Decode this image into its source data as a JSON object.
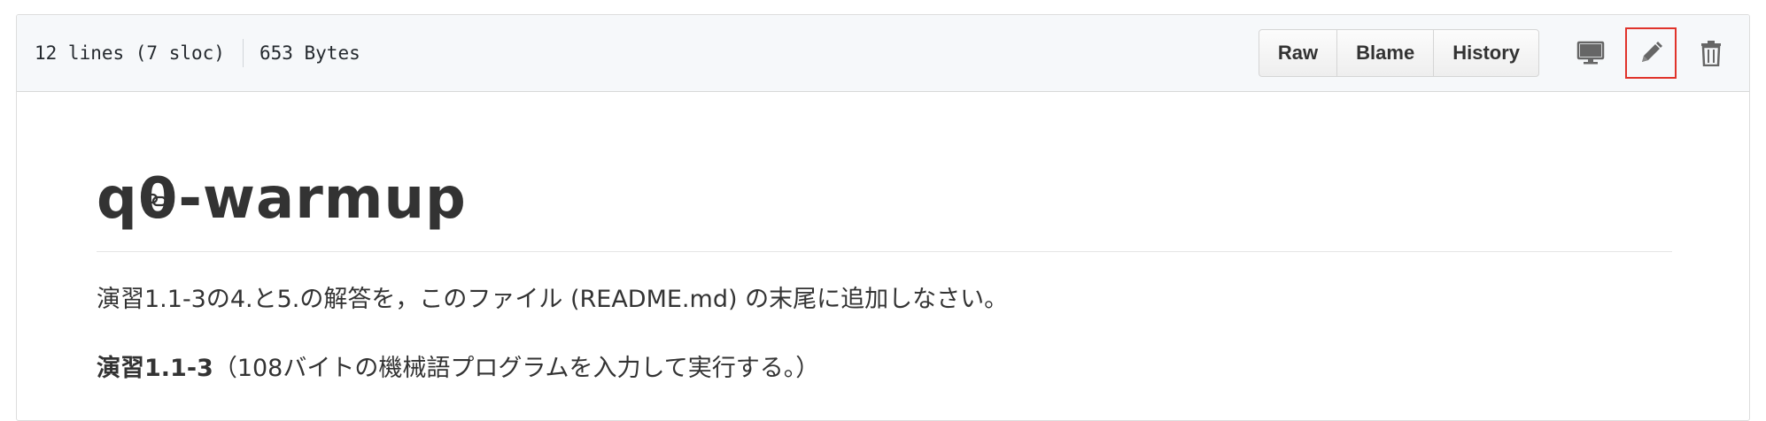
{
  "file_info": {
    "lines": "12 lines (7 sloc)",
    "size": "653 Bytes"
  },
  "toolbar": {
    "raw_label": "Raw",
    "blame_label": "Blame",
    "history_label": "History",
    "icons": [
      "desktop-icon",
      "pencil-icon",
      "trash-icon"
    ]
  },
  "readme": {
    "title": "q0-warmup",
    "paragraph1": "演習1.1-3の4.と5.の解答を，このファイル (README.md) の末尾に追加しなさい。",
    "paragraph2_bold": "演習1.1-3",
    "paragraph2_rest": "（108バイトの機械語プログラムを入力して実行する。）"
  },
  "colors": {
    "highlight_border": "#e0332b",
    "header_bg": "#f6f8fa"
  }
}
